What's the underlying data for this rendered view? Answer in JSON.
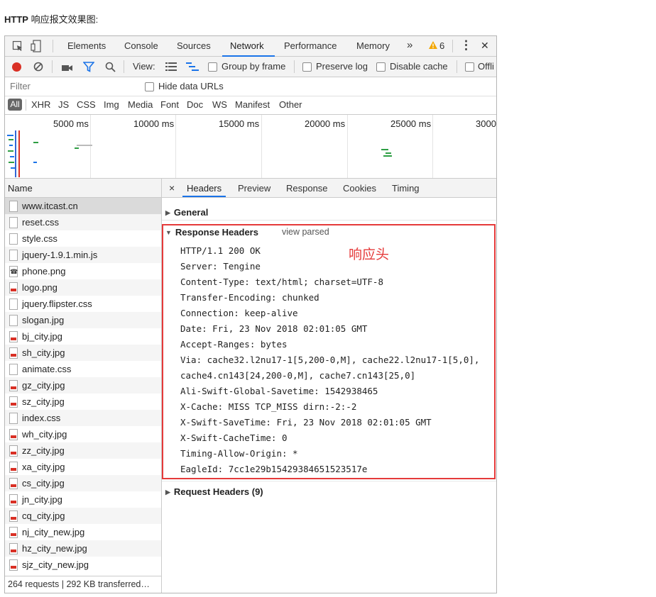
{
  "caption": {
    "bold": "HTTP",
    "rest": " 响应报文效果图:"
  },
  "devtools": {
    "tabs": [
      "Elements",
      "Console",
      "Sources",
      "Network",
      "Performance",
      "Memory"
    ],
    "active_tab": "Network",
    "more": "»",
    "warning_count": "6",
    "kebab": "⋮",
    "close": "✕"
  },
  "toolbar": {
    "view_label": "View:",
    "group_by_frame": "Group by frame",
    "preserve_log": "Preserve log",
    "disable_cache": "Disable cache",
    "offline": "Offli"
  },
  "filter": {
    "placeholder": "Filter",
    "hide_data_urls": "Hide data URLs"
  },
  "types": [
    "All",
    "XHR",
    "JS",
    "CSS",
    "Img",
    "Media",
    "Font",
    "Doc",
    "WS",
    "Manifest",
    "Other"
  ],
  "timeline": {
    "ticks": [
      "5000 ms",
      "10000 ms",
      "15000 ms",
      "20000 ms",
      "25000 ms",
      "3000"
    ]
  },
  "requests": {
    "header": "Name",
    "files": [
      {
        "name": "www.itcast.cn",
        "type": "doc"
      },
      {
        "name": "reset.css",
        "type": "doc"
      },
      {
        "name": "style.css",
        "type": "doc"
      },
      {
        "name": "jquery-1.9.1.min.js",
        "type": "doc"
      },
      {
        "name": "phone.png",
        "type": "phone"
      },
      {
        "name": "logo.png",
        "type": "img"
      },
      {
        "name": "jquery.flipster.css",
        "type": "doc"
      },
      {
        "name": "slogan.jpg",
        "type": "doc"
      },
      {
        "name": "bj_city.jpg",
        "type": "img"
      },
      {
        "name": "sh_city.jpg",
        "type": "img"
      },
      {
        "name": "animate.css",
        "type": "doc"
      },
      {
        "name": "gz_city.jpg",
        "type": "img"
      },
      {
        "name": "sz_city.jpg",
        "type": "img"
      },
      {
        "name": "index.css",
        "type": "doc"
      },
      {
        "name": "wh_city.jpg",
        "type": "img"
      },
      {
        "name": "zz_city.jpg",
        "type": "img"
      },
      {
        "name": "xa_city.jpg",
        "type": "img"
      },
      {
        "name": "cs_city.jpg",
        "type": "img"
      },
      {
        "name": "jn_city.jpg",
        "type": "img"
      },
      {
        "name": "cq_city.jpg",
        "type": "img"
      },
      {
        "name": "nj_city_new.jpg",
        "type": "img"
      },
      {
        "name": "hz_city_new.jpg",
        "type": "img"
      },
      {
        "name": "sjz_city_new.jpg",
        "type": "img"
      }
    ],
    "status": "264 requests | 292 KB transferred…"
  },
  "details": {
    "close": "×",
    "tabs": [
      "Headers",
      "Preview",
      "Response",
      "Cookies",
      "Timing"
    ],
    "active_tab": "Headers",
    "general": "General",
    "response_headers": "Response Headers",
    "view_parsed": "view parsed",
    "annotation": "响应头",
    "lines": [
      "HTTP/1.1 200 OK",
      "Server: Tengine",
      "Content-Type: text/html; charset=UTF-8",
      "Transfer-Encoding: chunked",
      "Connection: keep-alive",
      "Date: Fri, 23 Nov 2018 02:01:05 GMT",
      "Accept-Ranges: bytes",
      "Via: cache32.l2nu17-1[5,200-0,M], cache22.l2nu17-1[5,0],",
      "cache4.cn143[24,200-0,M], cache7.cn143[25,0]",
      "Ali-Swift-Global-Savetime: 1542938465",
      "X-Cache: MISS TCP_MISS dirn:-2:-2",
      "X-Swift-SaveTime: Fri, 23 Nov 2018 02:01:05 GMT",
      "X-Swift-CacheTime: 0",
      "Timing-Allow-Origin: *",
      "EagleId: 7cc1e29b15429384651523517e"
    ],
    "request_headers": "Request Headers (9)"
  },
  "colors": {
    "record": "#d93025",
    "accent": "#1a73e8",
    "warning": "#f2a600",
    "annotation": "#e53a3a"
  }
}
